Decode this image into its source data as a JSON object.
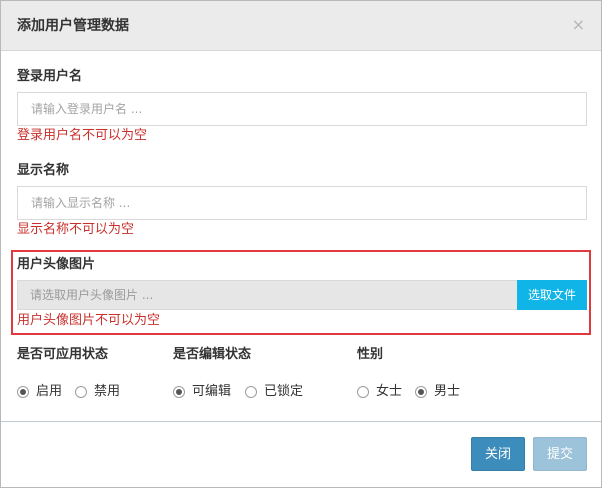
{
  "modal": {
    "title": "添加用户管理数据",
    "close_symbol": "×"
  },
  "login_name": {
    "label": "登录用户名",
    "placeholder": "请输入登录用户名 ...",
    "value": "",
    "error": "登录用户名不可以为空"
  },
  "display_name": {
    "label": "显示名称",
    "placeholder": "请输入显示名称 ...",
    "value": "",
    "error": "显示名称不可以为空"
  },
  "avatar": {
    "label": "用户头像图片",
    "placeholder": "请选取用户头像图片 ...",
    "button_label": "选取文件",
    "error": "用户头像图片不可以为空"
  },
  "status_group": {
    "label": "是否可应用状态",
    "options": [
      {
        "label": "启用",
        "checked": true
      },
      {
        "label": "禁用",
        "checked": false
      }
    ]
  },
  "edit_group": {
    "label": "是否编辑状态",
    "options": [
      {
        "label": "可编辑",
        "checked": true
      },
      {
        "label": "已锁定",
        "checked": false
      }
    ]
  },
  "gender_group": {
    "label": "性别",
    "options": [
      {
        "label": "女士",
        "checked": false
      },
      {
        "label": "男士",
        "checked": true
      }
    ]
  },
  "footer": {
    "close_label": "关闭",
    "submit_label": "提交"
  },
  "colors": {
    "error": "#c9302c",
    "highlight_border": "#e0393e",
    "choose_button": "#11b4e6",
    "primary_button": "#3c8dbc",
    "disabled_button": "#9cc3d9"
  }
}
